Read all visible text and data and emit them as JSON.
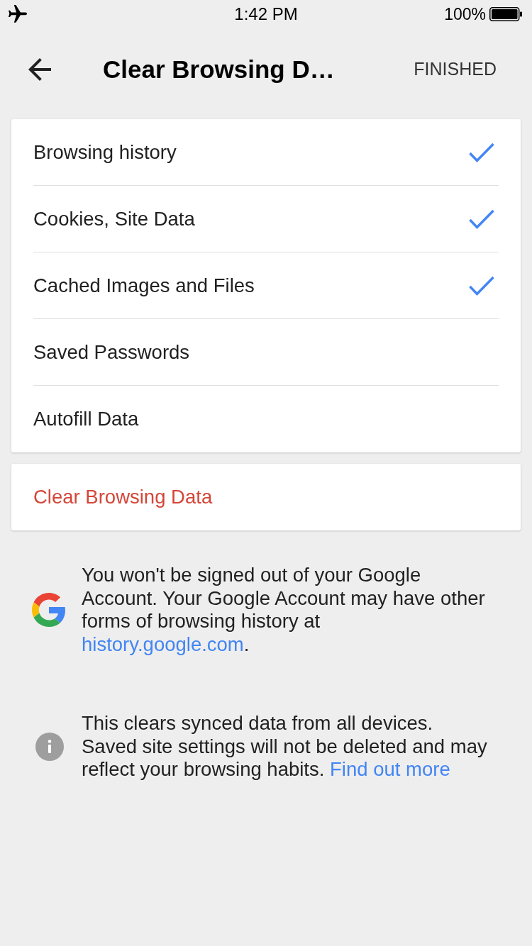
{
  "status_bar": {
    "time": "1:42 PM",
    "battery": "100%"
  },
  "nav": {
    "title": "Clear Browsing D…",
    "action": "FINISHED"
  },
  "options": [
    {
      "label": "Browsing history",
      "checked": true
    },
    {
      "label": "Cookies, Site Data",
      "checked": true
    },
    {
      "label": "Cached Images and Files",
      "checked": true
    },
    {
      "label": "Saved Passwords",
      "checked": false
    },
    {
      "label": "Autofill Data",
      "checked": false
    }
  ],
  "clear_button": {
    "label": "Clear Browsing Data"
  },
  "notes": [
    {
      "kind": "google",
      "text": "You won't be signed out of your Google\nAccount. Your Google Account may have other\nforms of browsing history at\n",
      "link": "history.google.com",
      "after": "."
    },
    {
      "kind": "info",
      "text": "This clears synced data from all devices.\nSaved site settings will not be deleted and may\nreflect your browsing habits. ",
      "link": "Find out more"
    }
  ]
}
